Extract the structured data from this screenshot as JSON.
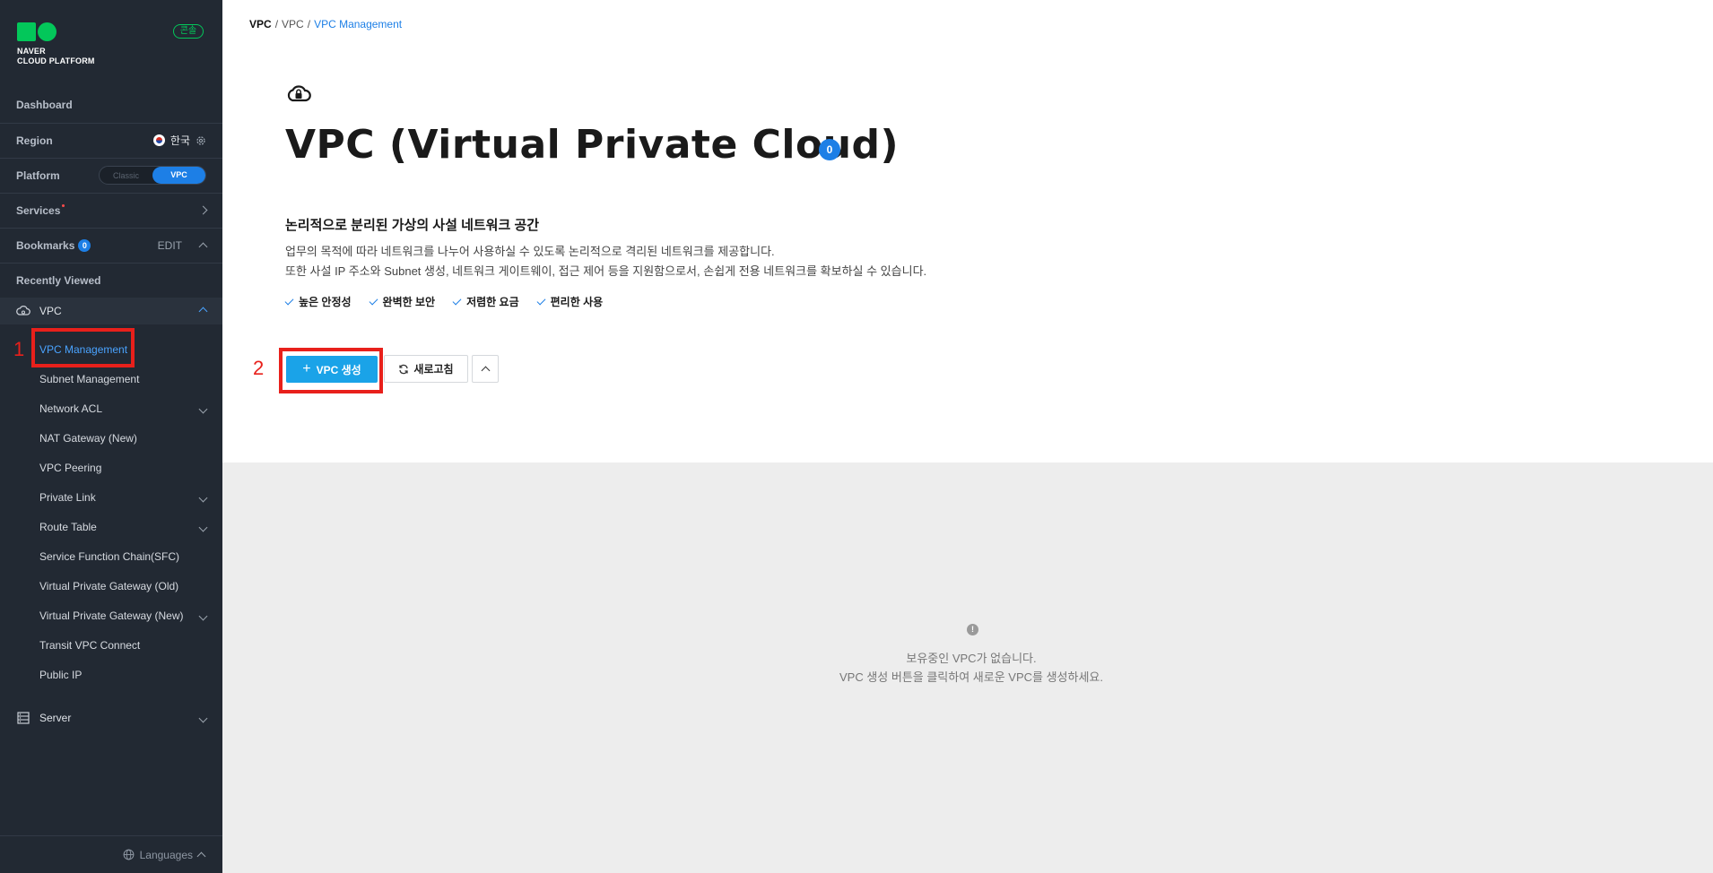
{
  "sidebar": {
    "logo_line1": "NAVER",
    "logo_line2": "CLOUD PLATFORM",
    "console_badge": "콘솔",
    "dashboard": "Dashboard",
    "region_label": "Region",
    "region_value": "한국",
    "platform_label": "Platform",
    "platform_options": [
      "Classic",
      "VPC"
    ],
    "platform_selected": "VPC",
    "services": "Services",
    "bookmarks": "Bookmarks",
    "bookmarks_count": "0",
    "bookmarks_edit": "EDIT",
    "recently_viewed": "Recently Viewed",
    "vpc_group": "VPC",
    "vpc_items": [
      {
        "label": "VPC Management",
        "active": true,
        "expandable": false
      },
      {
        "label": "Subnet Management",
        "expandable": false
      },
      {
        "label": "Network ACL",
        "expandable": true
      },
      {
        "label": "NAT Gateway (New)",
        "expandable": false
      },
      {
        "label": "VPC Peering",
        "expandable": false
      },
      {
        "label": "Private Link",
        "expandable": true
      },
      {
        "label": "Route Table",
        "expandable": true
      },
      {
        "label": "Service Function Chain(SFC)",
        "expandable": false
      },
      {
        "label": "Virtual Private Gateway (Old)",
        "expandable": false
      },
      {
        "label": "Virtual Private Gateway (New)",
        "expandable": true
      },
      {
        "label": "Transit VPC Connect",
        "expandable": false
      },
      {
        "label": "Public IP",
        "expandable": false
      }
    ],
    "server_group": "Server",
    "languages": "Languages"
  },
  "annotations": {
    "num1": "1",
    "num2": "2",
    "color": "#e8201b"
  },
  "breadcrumb": [
    "VPC",
    "VPC",
    "VPC Management"
  ],
  "main": {
    "title": "VPC (Virtual Private Cloud)",
    "info_badge": "0",
    "subtitle": "논리적으로 분리된 가상의 사설 네트워크 공간",
    "desc_line1": "업무의 목적에 따라 네트워크를 나누어 사용하실 수 있도록 논리적으로 격리된 네트워크를 제공합니다.",
    "desc_line2": "또한 사설 IP 주소와 Subnet 생성, 네트워크 게이트웨이, 접근 제어 등을 지원함으로서, 손쉽게 전용 네트워크를 확보하실 수 있습니다.",
    "features": [
      "높은 안정성",
      "완벽한 보안",
      "저렴한 요금",
      "편리한 사용"
    ],
    "create_button": "VPC 생성",
    "refresh_button": "새로고침",
    "empty_icon": "!",
    "empty_line1": "보유중인 VPC가 없습니다.",
    "empty_line2": "VPC 생성 버튼을 클릭하여 새로운 VPC를 생성하세요."
  },
  "colors": {
    "sidebar_bg": "#222933",
    "accent_blue": "#1d7fe6",
    "create_button": "#1aa3e8",
    "brand_green": "#03c75a"
  }
}
